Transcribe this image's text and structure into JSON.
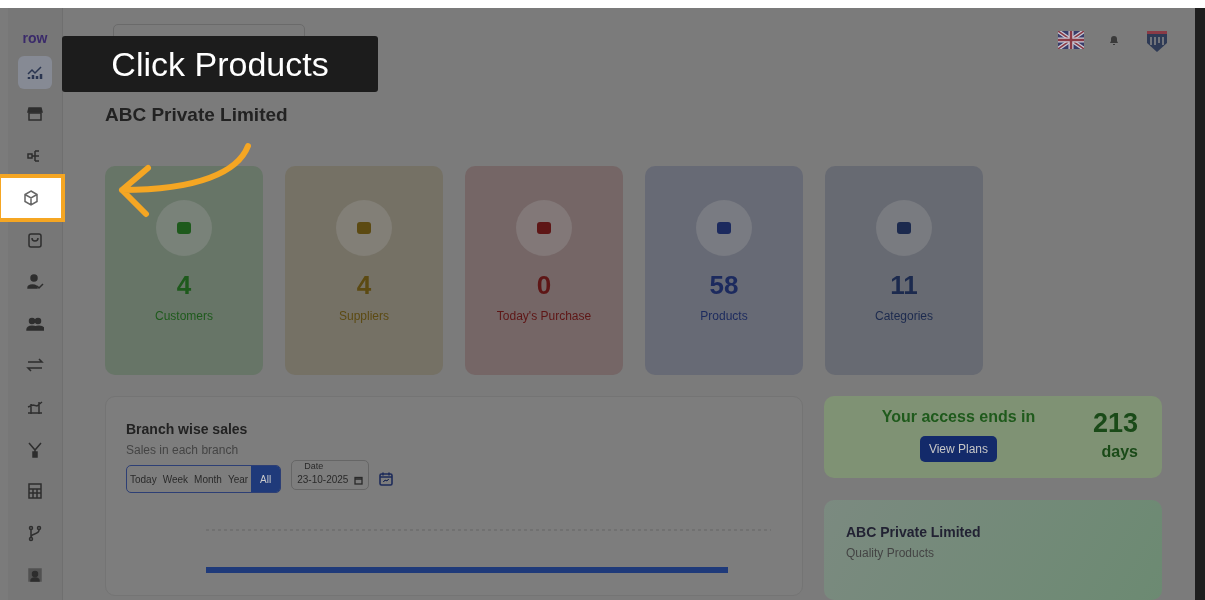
{
  "tutorial": {
    "callout": "Click Products"
  },
  "sidebar": {
    "logo": "row",
    "items": [
      {
        "selected": true,
        "highlighted": false
      },
      {
        "selected": false,
        "highlighted": false
      },
      {
        "selected": false,
        "highlighted": false
      },
      {
        "selected": false,
        "highlighted": true
      },
      {
        "selected": false,
        "highlighted": false
      },
      {
        "selected": false,
        "highlighted": false
      },
      {
        "selected": false,
        "highlighted": false
      },
      {
        "selected": false,
        "highlighted": false
      },
      {
        "selected": false,
        "highlighted": false
      },
      {
        "selected": false,
        "highlighted": false
      },
      {
        "selected": false,
        "highlighted": false
      },
      {
        "selected": false,
        "highlighted": false
      },
      {
        "selected": false,
        "highlighted": false
      }
    ]
  },
  "page_title": "ABC Private Limited",
  "stats": [
    {
      "value": "4",
      "label": "Customers",
      "color": "#1e5a1c"
    },
    {
      "value": "4",
      "label": "Suppliers",
      "color": "#5c4a12"
    },
    {
      "value": "0",
      "label": "Today's Purchase",
      "color": "#5e1616"
    },
    {
      "value": "58",
      "label": "Products",
      "color": "#1c2a5e"
    },
    {
      "value": "11",
      "label": "Categories",
      "color": "#1c2a4e"
    }
  ],
  "branch_sales": {
    "title": "Branch wise sales",
    "subtitle": "Sales in each branch",
    "periods": [
      {
        "label": "Today",
        "selected": false
      },
      {
        "label": "Week",
        "selected": false
      },
      {
        "label": "Month",
        "selected": false
      },
      {
        "label": "Year",
        "selected": false
      },
      {
        "label": "All",
        "selected": true
      }
    ],
    "date": {
      "label": "Date",
      "value": "23-10-2025"
    }
  },
  "access": {
    "text": "Your access ends in",
    "button": "View Plans",
    "count": "213",
    "unit": "days"
  },
  "company": {
    "name": "ABC Private Limited",
    "tagline": "Quality Products"
  }
}
